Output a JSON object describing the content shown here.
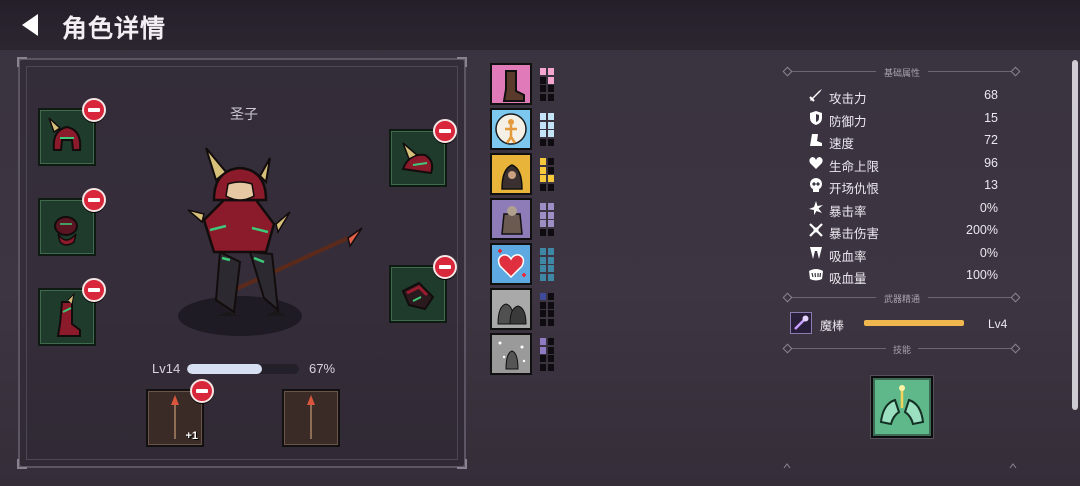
{
  "header": {
    "title": "角色详情"
  },
  "character": {
    "name": "圣子",
    "level_label": "Lv14",
    "xp_percent_label": "67%",
    "xp_fraction": 0.67
  },
  "equipment": {
    "weapon_bonus": "+1"
  },
  "buffs": [
    {
      "icon": "boot-icon",
      "bg": "#e07ab8",
      "pip_color": "#f4a6d0",
      "filled": [
        1,
        1,
        0,
        1,
        0,
        0,
        0,
        0
      ]
    },
    {
      "icon": "sun-figure-icon",
      "bg": "#7cc8ef",
      "pip_color": "#c3e3f7",
      "filled": [
        1,
        1,
        1,
        1,
        1,
        1,
        0,
        0
      ]
    },
    {
      "icon": "hooded-rogue-icon",
      "bg": "#e9b43a",
      "pip_color": "#f5c93a",
      "filled": [
        1,
        0,
        1,
        0,
        1,
        1,
        0,
        0
      ]
    },
    {
      "icon": "armored-warrior-icon",
      "bg": "#8e7cb8",
      "pip_color": "#9d8fc6",
      "filled": [
        1,
        1,
        1,
        1,
        1,
        1,
        0,
        0
      ]
    },
    {
      "icon": "heart-heal-icon",
      "bg": "#5fa9e2",
      "pip_color": "#3f87a7",
      "filled": [
        1,
        1,
        1,
        1,
        1,
        1,
        1,
        1
      ]
    },
    {
      "icon": "dark-figures-icon",
      "bg": "#a9a9a9",
      "pip_color": "#3f4a9a",
      "filled": [
        1,
        0,
        0,
        0,
        0,
        0,
        0,
        0
      ]
    },
    {
      "icon": "snow-figure-icon",
      "bg": "#9a9a9a",
      "pip_color": "#8f7bc4",
      "filled": [
        1,
        0,
        1,
        0,
        0,
        0,
        0,
        0
      ]
    }
  ],
  "stats": {
    "section_title": "基础属性",
    "items": [
      {
        "icon": "sword-icon",
        "label": "攻击力",
        "value": "68"
      },
      {
        "icon": "shield-icon",
        "label": "防御力",
        "value": "15"
      },
      {
        "icon": "boot-speed-icon",
        "label": "速度",
        "value": "72"
      },
      {
        "icon": "heart-icon",
        "label": "生命上限",
        "value": "96"
      },
      {
        "icon": "skull-icon",
        "label": "开场仇恨",
        "value": "13"
      },
      {
        "icon": "crit-burst-icon",
        "label": "暴击率",
        "value": "0%"
      },
      {
        "icon": "crit-damage-icon",
        "label": "暴击伤害",
        "value": "200%"
      },
      {
        "icon": "fang-icon",
        "label": "吸血率",
        "value": "0%"
      },
      {
        "icon": "jaw-icon",
        "label": "吸血量",
        "value": "100%"
      }
    ]
  },
  "weapon_mastery": {
    "section_title": "武器精通",
    "icon": "magic-wand-icon",
    "name": "魔棒",
    "level": "Lv4",
    "bar_color": "#f0b74f"
  },
  "skills": {
    "section_title": "技能",
    "icon": "healing-hands-icon"
  },
  "colors": {
    "accent_red": "#d8263a",
    "slot_green": "#1f3b2c"
  }
}
